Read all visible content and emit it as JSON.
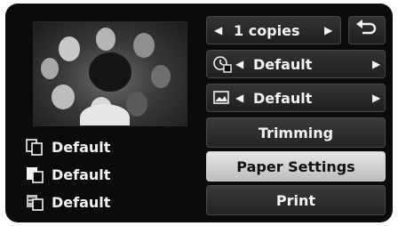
{
  "copies": {
    "label": "1 copies",
    "left_arrow": "◀",
    "right_arrow": "▶"
  },
  "date_print": {
    "label": "Default",
    "left_arrow": "◀",
    "right_arrow": "▶"
  },
  "image_print": {
    "label": "Default",
    "left_arrow": "◀",
    "right_arrow": "▶"
  },
  "buttons": {
    "trimming": "Trimming",
    "paper_settings": "Paper Settings",
    "print": "Print"
  },
  "status": {
    "paper_size": "Default",
    "paper_type": "Default",
    "layout": "Default"
  },
  "icons": {
    "back": "return-arrow-icon",
    "date": "date-stamp-icon",
    "image": "image-effect-icon",
    "paper_size": "paper-size-icon",
    "paper_type": "paper-type-icon",
    "layout": "layout-icon"
  },
  "colors": {
    "screen_bg": "#0b0b0b",
    "button_bg": "#2b2b2b",
    "selected_bg": "#d4d4d4",
    "text": "#f2f2f2"
  }
}
